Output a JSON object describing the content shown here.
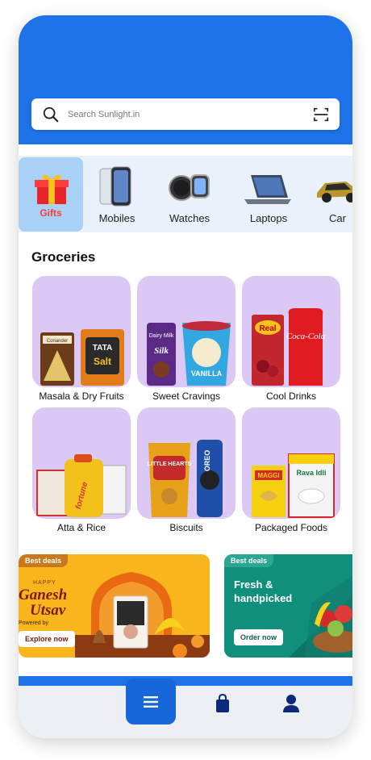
{
  "colors": {
    "header": "#1e73e8",
    "tile": "#dcc8f5",
    "accent_text": "#ff3b3b",
    "nav": "#1668d8"
  },
  "search": {
    "placeholder": "Search Sunlight.in",
    "icon": "search-icon",
    "scan_icon": "scan-icon"
  },
  "categories": [
    {
      "label": "Gifts",
      "icon": "gift-icon",
      "active": true
    },
    {
      "label": "Mobiles",
      "icon": "phone-icon"
    },
    {
      "label": "Watches",
      "icon": "watch-icon"
    },
    {
      "label": "Laptops",
      "icon": "laptop-icon"
    },
    {
      "label": "Car",
      "icon": "car-icon"
    }
  ],
  "groceries": {
    "title": "Groceries",
    "items": [
      {
        "label": "Masala & Dry Fruits",
        "product_text": [
          "Coriander",
          "TATA",
          "Salt"
        ]
      },
      {
        "label": "Sweet Cravings",
        "product_text": [
          "Dairy Milk",
          "Silk",
          "VANILLA"
        ]
      },
      {
        "label": "Cool Drinks",
        "product_text": [
          "Real",
          "Coca-Cola"
        ]
      },
      {
        "label": "Atta & Rice",
        "product_text": [
          "fortune"
        ]
      },
      {
        "label": "Biscuits",
        "product_text": [
          "LITTLE HEARTS",
          "OREO"
        ]
      },
      {
        "label": "Packaged Foods",
        "product_text": [
          "MAGGI",
          "Rava Idli"
        ]
      }
    ]
  },
  "banners": [
    {
      "badge": "Best deals",
      "line1": "Happy",
      "line2": "Ganesh",
      "line3": "Utsav",
      "powered": "Powered by",
      "cta": "Explore now"
    },
    {
      "badge": "Best deals",
      "title1": "Fresh &",
      "title2": "handpicked",
      "cta": "Order now"
    }
  ],
  "bottom_nav": {
    "items": [
      "menu-icon",
      "bag-icon",
      "user-icon"
    ]
  }
}
